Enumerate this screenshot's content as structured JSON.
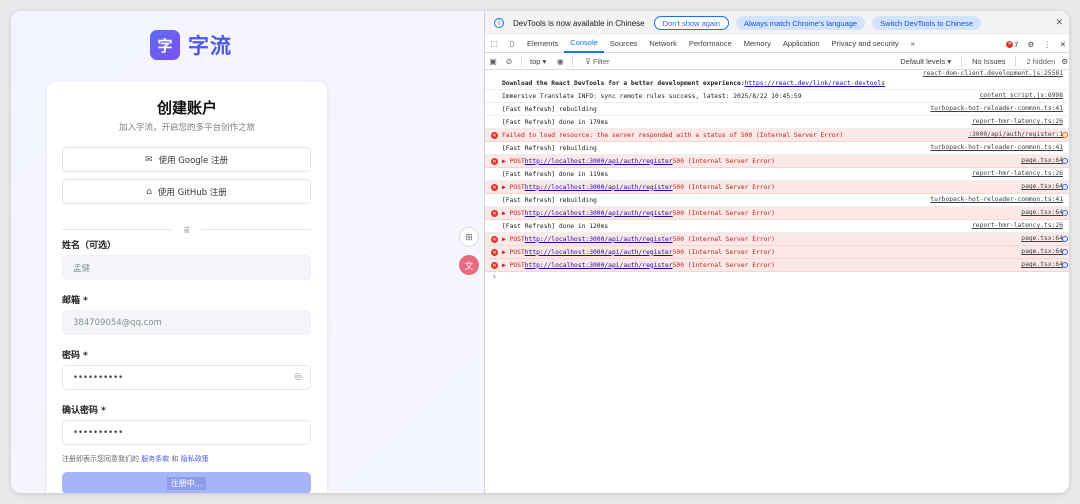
{
  "app": {
    "logo_char": "字",
    "brand_name": "字流",
    "title": "创建账户",
    "subtitle": "加入字流，开启您的多平台创作之旅",
    "google_btn": "使用 Google 注册",
    "github_btn": "使用 GitHub 注册",
    "divider": "或",
    "name_label": "姓名（可选）",
    "name_value": "孟健",
    "email_label": "邮箱 *",
    "email_value": "384709054@qq.com",
    "password_label": "密码 *",
    "password_value": "••••••••••",
    "confirm_label": "确认密码 *",
    "confirm_value": "••••••••••",
    "terms_prefix": "注册即表示您同意我们的",
    "terms_link": "服务条款",
    "terms_and": "和",
    "privacy_link": "隐私政策",
    "submit_label": "注册中..."
  },
  "devtools": {
    "infobar": {
      "message": "DevTools is now available in Chinese",
      "btn_dont_show": "Don't show again",
      "btn_match": "Always match Chrome's language",
      "btn_switch": "Switch DevTools to Chinese"
    },
    "tabs": [
      "Elements",
      "Console",
      "Sources",
      "Network",
      "Performance",
      "Memory",
      "Application",
      "Privacy and security"
    ],
    "active_tab": "Console",
    "more_tabs": "»",
    "error_count": "7",
    "context": "top ▾",
    "filter_placeholder": "Filter",
    "levels": "Default levels ▾",
    "issues": "No Issues",
    "hidden": "2 hidden",
    "rows": [
      {
        "type": "info",
        "tall": true,
        "text_bold": "Download the React DevTools for a better development experience: ",
        "link": "https://react.dev/link/react-devtools",
        "source": "react-dom-client.development.js:25581"
      },
      {
        "type": "info",
        "text": "Immersive Translate INFO: sync remote rules success, latest: 2025/8/22 10:45:59",
        "source": "content_script.js:6998"
      },
      {
        "type": "info",
        "text": "[Fast Refresh] rebuilding",
        "source": "turbopack-hot-reloader-common.ts:41"
      },
      {
        "type": "info",
        "text": "[Fast Refresh] done in 179ms",
        "source": "report-hmr-latency.ts:26"
      },
      {
        "type": "error",
        "text": "Failed to load resource: the server responded with a status of 500 (Internal Server Error)",
        "source": ":3000/api/auth/register:1",
        "orange": true
      },
      {
        "type": "info",
        "text": "[Fast Refresh] rebuilding",
        "source": "turbopack-hot-reloader-common.ts:41"
      },
      {
        "type": "error",
        "pre": "▶ POST ",
        "link": "http://localhost:3000/api/auth/register",
        "post": " 500 (Internal Server Error)",
        "source": "page.tsx:64"
      },
      {
        "type": "info",
        "text": "[Fast Refresh] done in 119ms",
        "source": "report-hmr-latency.ts:26"
      },
      {
        "type": "error",
        "pre": "▶ POST ",
        "link": "http://localhost:3000/api/auth/register",
        "post": " 500 (Internal Server Error)",
        "source": "page.tsx:64"
      },
      {
        "type": "info",
        "text": "[Fast Refresh] rebuilding",
        "source": "turbopack-hot-reloader-common.ts:41"
      },
      {
        "type": "error",
        "pre": "▶ POST ",
        "link": "http://localhost:3000/api/auth/register",
        "post": " 500 (Internal Server Error)",
        "source": "page.tsx:64"
      },
      {
        "type": "info",
        "text": "[Fast Refresh] done in 120ms",
        "source": "report-hmr-latency.ts:26"
      },
      {
        "type": "error",
        "pre": "▶ POST ",
        "link": "http://localhost:3000/api/auth/register",
        "post": " 500 (Internal Server Error)",
        "source": "page.tsx:64"
      },
      {
        "type": "error",
        "pre": "▶ POST ",
        "link": "http://localhost:3000/api/auth/register",
        "post": " 500 (Internal Server Error)",
        "source": "page.tsx:64"
      },
      {
        "type": "error",
        "pre": "▶ POST ",
        "link": "http://localhost:3000/api/auth/register",
        "post": " 500 (Internal Server Error)",
        "source": "page.tsx:64"
      }
    ],
    "prompt": "›"
  },
  "colors": {
    "brand": "#4f57e8",
    "tab_active": "#1a73e8",
    "error_red": "#dc362e",
    "error_bg": "#fce8e6"
  }
}
